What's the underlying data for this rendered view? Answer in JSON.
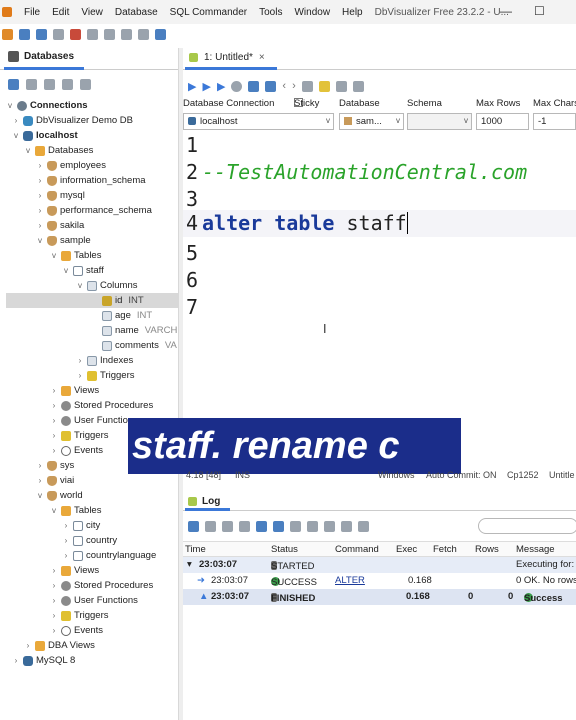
{
  "menubar": {
    "items": [
      "File",
      "Edit",
      "View",
      "Database",
      "SQL Commander",
      "Tools",
      "Window",
      "Help"
    ],
    "window_title": "DbVisualizer Free 23.2.2 - U..."
  },
  "databases_panel": {
    "tab_label": "Databases",
    "tree": [
      {
        "label": "Connections",
        "bold": true
      },
      {
        "label": "DbVisualizer Demo DB"
      },
      {
        "label": "localhost",
        "bold": true
      },
      {
        "label": "Databases"
      },
      {
        "label": "employees"
      },
      {
        "label": "information_schema"
      },
      {
        "label": "mysql"
      },
      {
        "label": "performance_schema"
      },
      {
        "label": "sakila"
      },
      {
        "label": "sample"
      },
      {
        "label": "Tables"
      },
      {
        "label": "staff"
      },
      {
        "label": "Columns"
      },
      {
        "label": "id",
        "type": "INT"
      },
      {
        "label": "age",
        "type": "INT"
      },
      {
        "label": "name",
        "type": "VARCH"
      },
      {
        "label": "comments",
        "type": "VA"
      },
      {
        "label": "Indexes"
      },
      {
        "label": "Triggers"
      },
      {
        "label": "Views"
      },
      {
        "label": "Stored Procedures"
      },
      {
        "label": "User Functio"
      },
      {
        "label": "Triggers"
      },
      {
        "label": "Events"
      },
      {
        "label": "sys"
      },
      {
        "label": "viai"
      },
      {
        "label": "world"
      },
      {
        "label": "Tables"
      },
      {
        "label": "city"
      },
      {
        "label": "country"
      },
      {
        "label": "countrylanguage"
      },
      {
        "label": "Views"
      },
      {
        "label": "Stored Procedures"
      },
      {
        "label": "User Functions"
      },
      {
        "label": "Triggers"
      },
      {
        "label": "Events"
      },
      {
        "label": "DBA Views"
      },
      {
        "label": "MySQL 8"
      }
    ]
  },
  "editor_panel": {
    "tab_label": "1: Untitled*",
    "labels": {
      "database_connection": "Database Connection",
      "sticky": "Sticky",
      "database": "Database",
      "schema": "Schema",
      "max_rows": "Max Rows",
      "max_chars": "Max Chars"
    },
    "fields": {
      "connection": "localhost",
      "database": "sam...",
      "schema": "",
      "max_rows": "1000",
      "max_chars": "-1"
    },
    "code_lines": [
      {
        "num": "1",
        "text": ""
      },
      {
        "num": "2",
        "text": "--TestAutomationCentral.com"
      },
      {
        "num": "3",
        "text": ""
      },
      {
        "num": "4",
        "kw": "alter table",
        "rest": " staff"
      },
      {
        "num": "5",
        "text": ""
      },
      {
        "num": "6",
        "text": ""
      },
      {
        "num": "7",
        "text": ""
      }
    ],
    "status": {
      "position": "4:18 [48]",
      "mode": "INS",
      "os": "Windows",
      "autocommit": "Auto Commit: ON",
      "encoding": "Cp1252",
      "file": "Untitle"
    }
  },
  "caption": "staff. rename c",
  "log_panel": {
    "tab_label": "Log",
    "headers": [
      "Time",
      "Status",
      "Command",
      "Exec",
      "Fetch",
      "Rows",
      "Message"
    ],
    "rows": [
      {
        "time": "23:03:07",
        "status": "STARTED",
        "command": "",
        "exec": "",
        "fetch": "",
        "rows": "",
        "message": "Executing for:"
      },
      {
        "time": "23:03:07",
        "status": "SUCCESS",
        "command": "ALTER",
        "exec": "0.168",
        "fetch": "",
        "rows": "",
        "message": "0 OK. No rows w"
      },
      {
        "time": "23:03:07",
        "status": "FINISHED",
        "command": "",
        "exec": "0.168",
        "fetch": "0",
        "rows": "0",
        "message": "Success"
      }
    ]
  }
}
